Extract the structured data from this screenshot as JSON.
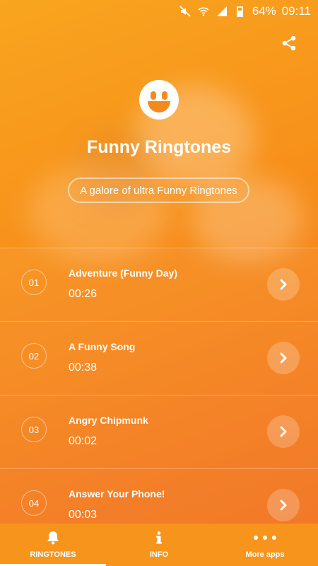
{
  "status_bar": {
    "battery": "64%",
    "time": "09:11",
    "icons": [
      "mute-icon",
      "wifi-icon",
      "signal-icon",
      "battery-icon"
    ]
  },
  "header": {
    "share_icon": "share-icon",
    "logo_icon": "smiley-icon",
    "title": "Funny Ringtones",
    "tagline": "A galore of ultra Funny Ringtones"
  },
  "ringtones": [
    {
      "number": "01",
      "title": "Adventure (Funny Day)",
      "duration": "00:26"
    },
    {
      "number": "02",
      "title": "A Funny Song",
      "duration": "00:38"
    },
    {
      "number": "03",
      "title": "Angry Chipmunk",
      "duration": "00:02"
    },
    {
      "number": "04",
      "title": "Answer Your Phone!",
      "duration": "00:03"
    }
  ],
  "bottom_nav": [
    {
      "label": "RINGTONES",
      "icon": "bell-icon",
      "active": true
    },
    {
      "label": "INFO",
      "icon": "info-icon",
      "active": false
    },
    {
      "label": "More apps",
      "icon": "more-dots-icon",
      "active": false
    }
  ],
  "colors": {
    "accent": "#f7941c",
    "background_start": "#f9a51f",
    "background_end": "#f06e1e"
  }
}
